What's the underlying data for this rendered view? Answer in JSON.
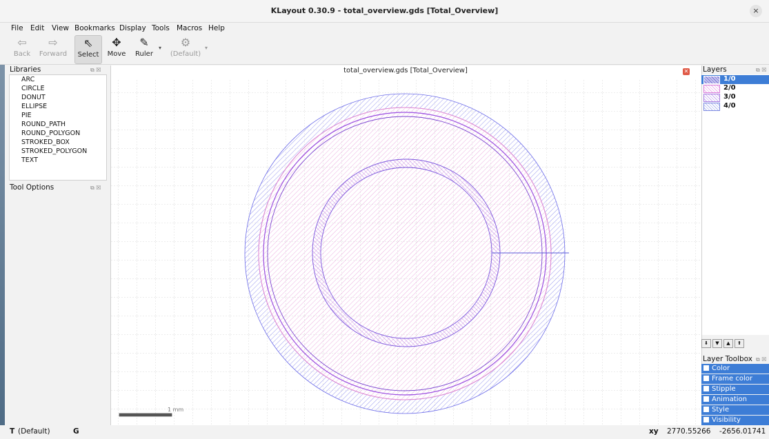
{
  "window": {
    "title": "KLayout 0.30.9 - total_overview.gds [Total_Overview]",
    "close_glyph": "×"
  },
  "menu": [
    "File",
    "Edit",
    "View",
    "Bookmarks",
    "Display",
    "Tools",
    "Macros",
    "Help"
  ],
  "toolbar": {
    "back": "Back",
    "forward": "Forward",
    "select": "Select",
    "move": "Move",
    "ruler": "Ruler",
    "default": "(Default)"
  },
  "libraries": {
    "title": "Libraries",
    "items": [
      "ARC",
      "CIRCLE",
      "DONUT",
      "ELLIPSE",
      "PIE",
      "ROUND_PATH",
      "ROUND_POLYGON",
      "STROKED_BOX",
      "STROKED_POLYGON",
      "TEXT"
    ]
  },
  "tool_options": {
    "title": "Tool Options"
  },
  "canvas": {
    "title": "total_overview.gds [Total_Overview]",
    "scale_label": "1 mm"
  },
  "layers": {
    "title": "Layers",
    "items": [
      {
        "name": "1/0",
        "color": "#7a6fd6",
        "selected": true
      },
      {
        "name": "2/0",
        "color": "#d97ad9",
        "selected": false
      },
      {
        "name": "3/0",
        "color": "#a67be0",
        "selected": false
      },
      {
        "name": "4/0",
        "color": "#7a88e0",
        "selected": false
      }
    ]
  },
  "layer_toolbox": {
    "title": "Layer Toolbox",
    "items": [
      "Color",
      "Frame color",
      "Stipple",
      "Animation",
      "Style",
      "Visibility"
    ]
  },
  "status": {
    "mode": "(Default)",
    "mode_prefix": "T",
    "grid": "G",
    "xy_label": "xy",
    "x": "2770.55266",
    "y": "-2656.01741"
  },
  "colors": {
    "accent": "#3d7dd6",
    "layer_blue": "#6a6ae8",
    "layer_pink": "#e48ad2",
    "layer_purple": "#9a4ee0"
  }
}
